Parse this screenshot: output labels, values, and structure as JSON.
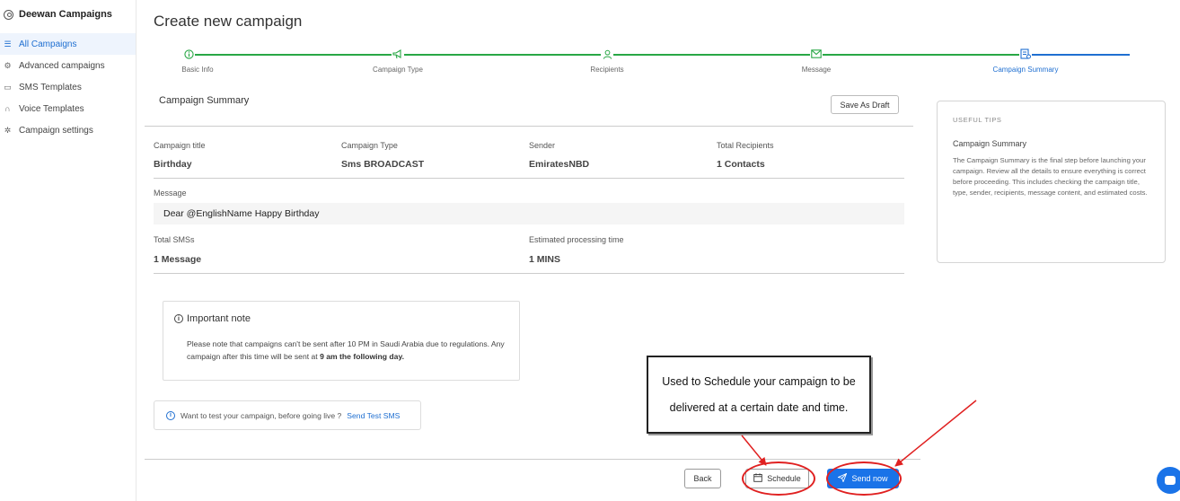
{
  "sidebar": {
    "brand": "Deewan Campaigns",
    "items": [
      {
        "label": "All Campaigns",
        "icon": "list-icon"
      },
      {
        "label": "Advanced campaigns",
        "icon": "gear-icon"
      },
      {
        "label": "SMS Templates",
        "icon": "folder-icon"
      },
      {
        "label": "Voice Templates",
        "icon": "headset-icon"
      },
      {
        "label": "Campaign settings",
        "icon": "settings-icon"
      }
    ]
  },
  "page": {
    "title": "Create new campaign"
  },
  "stepper": {
    "steps": [
      {
        "label": "Basic Info",
        "icon": "info-icon"
      },
      {
        "label": "Campaign Type",
        "icon": "megaphone-icon"
      },
      {
        "label": "Recipients",
        "icon": "user-icon"
      },
      {
        "label": "Message",
        "icon": "envelope-icon"
      },
      {
        "label": "Campaign Summary",
        "icon": "summary-icon"
      }
    ],
    "complete_color": "#28a745",
    "current_color": "#1f6fd1"
  },
  "summary": {
    "title": "Campaign Summary",
    "save_draft": "Save As Draft",
    "campaign_title_label": "Campaign title",
    "campaign_title_value": "Birthday",
    "campaign_type_label": "Campaign Type",
    "campaign_type_value": "Sms BROADCAST",
    "sender_label": "Sender",
    "sender_value": "EmiratesNBD",
    "recipients_label": "Total Recipients",
    "recipients_value": "1 Contacts",
    "message_label": "Message",
    "message_value": "Dear @EnglishName Happy Birthday",
    "total_sms_label": "Total SMSs",
    "total_sms_value": "1 Message",
    "processing_label": "Estimated processing time",
    "processing_value": "1 MINS"
  },
  "note": {
    "title": "Important note",
    "text": "Please note that campaigns can't be sent after 10 PM in Saudi Arabia due to regulations. Any campaign after this time will be sent at",
    "bold": "9 am the following day."
  },
  "test": {
    "text": "Want to test your campaign, before going live ?",
    "link": "Send Test SMS"
  },
  "tips": {
    "heading": "USEFUL TIPS",
    "title": "Campaign Summary",
    "body": "The Campaign Summary is the final step before launching your campaign. Review all the details to ensure everything is correct before proceeding. This includes checking the campaign title, type, sender, recipients, message content, and estimated costs."
  },
  "footer": {
    "back": "Back",
    "schedule": "Schedule",
    "send": "Send now"
  },
  "annotation": {
    "line1": "Used to Schedule your campaign to be",
    "line2": "delivered at a certain date and time.",
    "color": "#e02020"
  }
}
